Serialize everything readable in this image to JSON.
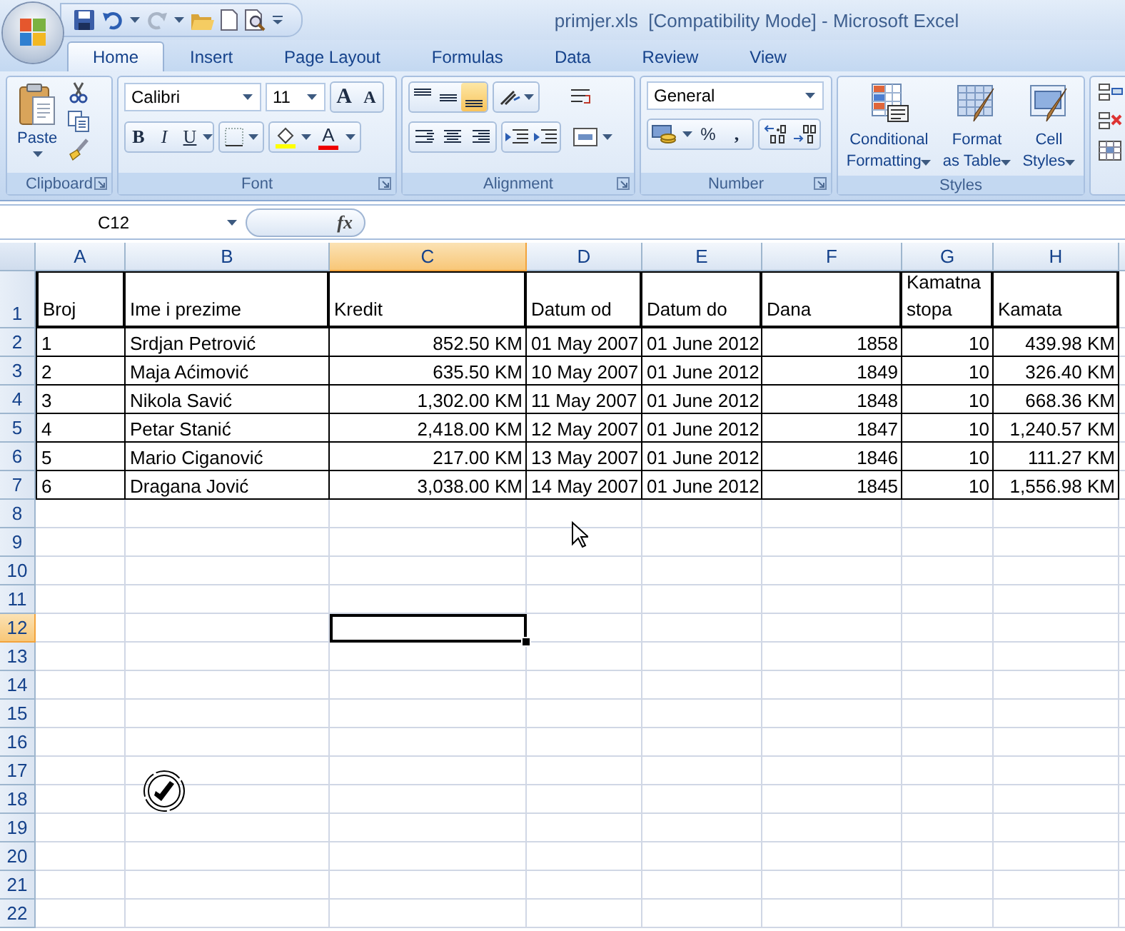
{
  "title_bar": {
    "title": "primjer.xls  [Compatibility Mode] - Microsoft Excel"
  },
  "tabs": [
    {
      "label": "Home",
      "selected": true
    },
    {
      "label": "Insert",
      "selected": false
    },
    {
      "label": "Page Layout",
      "selected": false
    },
    {
      "label": "Formulas",
      "selected": false
    },
    {
      "label": "Data",
      "selected": false
    },
    {
      "label": "Review",
      "selected": false
    },
    {
      "label": "View",
      "selected": false
    }
  ],
  "ribbon": {
    "clipboard": {
      "paste": "Paste",
      "label": "Clipboard"
    },
    "font": {
      "font_name": "Calibri",
      "font_size": "11",
      "grow_glyph": "A",
      "shrink_glyph": "A",
      "bold": "B",
      "italic": "I",
      "underline": "U",
      "font_color_glyph": "A",
      "label": "Font"
    },
    "alignment": {
      "vertical": [
        {
          "kind": "top",
          "selected": false
        },
        {
          "kind": "middle",
          "selected": false
        },
        {
          "kind": "bottom",
          "selected": true
        }
      ],
      "label": "Alignment"
    },
    "number": {
      "format": "General",
      "percent": "%",
      "comma": ",",
      "label": "Number"
    },
    "styles": {
      "buttons": [
        {
          "kind": "conditional",
          "lines": [
            "Conditional",
            "Formatting"
          ]
        },
        {
          "kind": "table",
          "lines": [
            "Format",
            "as Table"
          ]
        },
        {
          "kind": "cell",
          "lines": [
            "Cell",
            "Styles"
          ]
        }
      ],
      "label": "Styles"
    }
  },
  "formula_bar": {
    "name_box": "C12",
    "fx": "fx"
  },
  "sheet": {
    "columns": [
      {
        "letter": "A",
        "selected": false,
        "kind": "text"
      },
      {
        "letter": "B",
        "selected": false,
        "kind": "text"
      },
      {
        "letter": "C",
        "selected": true,
        "kind": "number"
      },
      {
        "letter": "D",
        "selected": false,
        "kind": "text"
      },
      {
        "letter": "E",
        "selected": false,
        "kind": "text"
      },
      {
        "letter": "F",
        "selected": false,
        "kind": "number"
      },
      {
        "letter": "G",
        "selected": false,
        "kind": "number"
      },
      {
        "letter": "H",
        "selected": false,
        "kind": "number"
      }
    ],
    "rows": [
      {
        "number": "1",
        "selected": false,
        "kind": "header",
        "cells": [
          "Broj",
          "Ime i prezime",
          "Kredit",
          "Datum od",
          "Datum do",
          "Dana",
          "Kamatna stopa",
          "Kamata"
        ]
      },
      {
        "number": "2",
        "selected": false,
        "kind": "data",
        "cells": [
          "1",
          "Srdjan Petrović",
          "852.50 KM",
          "01 May 2007",
          "01 June 2012",
          "1858",
          "10",
          "439.98 KM"
        ]
      },
      {
        "number": "3",
        "selected": false,
        "kind": "data",
        "cells": [
          "2",
          "Maja Aćimović",
          "635.50 KM",
          "10 May 2007",
          "01 June 2012",
          "1849",
          "10",
          "326.40 KM"
        ]
      },
      {
        "number": "4",
        "selected": false,
        "kind": "data",
        "cells": [
          "3",
          "Nikola Savić",
          "1,302.00 KM",
          "11 May 2007",
          "01 June 2012",
          "1848",
          "10",
          "668.36 KM"
        ]
      },
      {
        "number": "5",
        "selected": false,
        "kind": "data",
        "cells": [
          "4",
          "Petar Stanić",
          "2,418.00 KM",
          "12 May 2007",
          "01 June 2012",
          "1847",
          "10",
          "1,240.57 KM"
        ]
      },
      {
        "number": "6",
        "selected": false,
        "kind": "data",
        "cells": [
          "5",
          "Mario Ciganović",
          "217.00 KM",
          "13 May 2007",
          "01 June 2012",
          "1846",
          "10",
          "111.27 KM"
        ]
      },
      {
        "number": "7",
        "selected": false,
        "kind": "data",
        "cells": [
          "6",
          "Dragana Jović",
          "3,038.00 KM",
          "14 May 2007",
          "01 June 2012",
          "1845",
          "10",
          "1,556.98 KM"
        ]
      },
      {
        "number": "8",
        "selected": false,
        "kind": "empty"
      },
      {
        "number": "9",
        "selected": false,
        "kind": "empty"
      },
      {
        "number": "10",
        "selected": false,
        "kind": "empty"
      },
      {
        "number": "11",
        "selected": false,
        "kind": "empty"
      },
      {
        "number": "12",
        "selected": true,
        "kind": "empty"
      },
      {
        "number": "13",
        "selected": false,
        "kind": "empty"
      },
      {
        "number": "14",
        "selected": false,
        "kind": "empty"
      },
      {
        "number": "15",
        "selected": false,
        "kind": "empty"
      },
      {
        "number": "16",
        "selected": false,
        "kind": "empty"
      },
      {
        "number": "17",
        "selected": false,
        "kind": "empty"
      },
      {
        "number": "18",
        "selected": false,
        "kind": "empty"
      },
      {
        "number": "19",
        "selected": false,
        "kind": "empty"
      },
      {
        "number": "20",
        "selected": false,
        "kind": "empty"
      },
      {
        "number": "21",
        "selected": false,
        "kind": "empty"
      },
      {
        "number": "22",
        "selected": false,
        "kind": "empty"
      }
    ]
  }
}
